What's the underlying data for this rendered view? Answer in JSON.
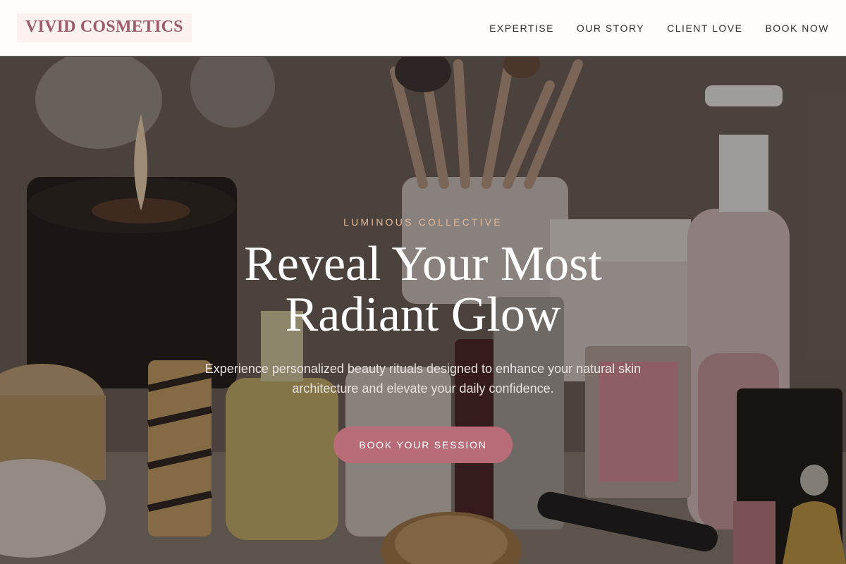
{
  "header": {
    "logo": "VIVID COSMETICS",
    "nav": [
      {
        "label": "EXPERTISE"
      },
      {
        "label": "OUR STORY"
      },
      {
        "label": "CLIENT LOVE"
      },
      {
        "label": "BOOK NOW"
      }
    ]
  },
  "hero": {
    "eyebrow": "LUMINOUS COLLECTIVE",
    "headline_line1": "Reveal Your Most",
    "headline_line2": "Radiant Glow",
    "subcopy": "Experience personalized beauty rituals designed to enhance your natural skin architecture and elevate your daily confidence.",
    "cta_label": "BOOK YOUR SESSION",
    "background_image": "cosmetics-vanity-photo"
  },
  "colors": {
    "brand": "#9d5c6b",
    "accent": "#b76c77",
    "eyebrow": "#e2b796",
    "header_bg": "#fffcfa"
  }
}
